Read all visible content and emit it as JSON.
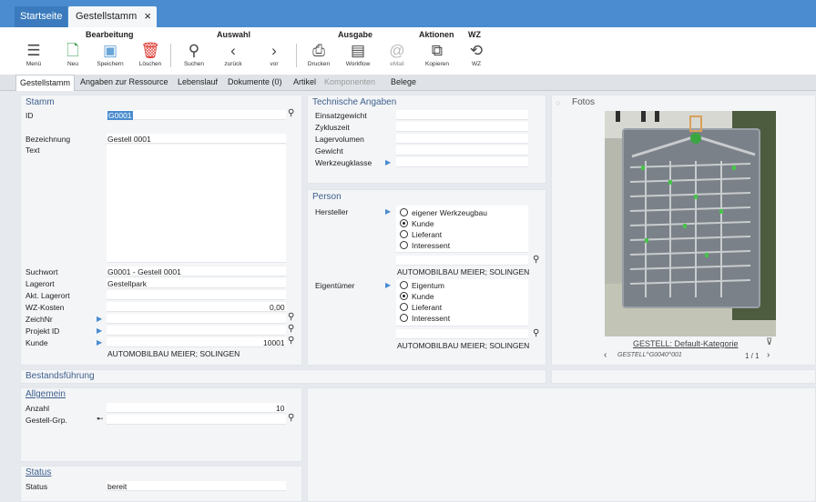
{
  "tabs": {
    "start": "Startseite",
    "current": "Gestellstamm",
    "close": "×"
  },
  "ribbon": {
    "groups": {
      "bearbeitung": "Bearbeitung",
      "auswahl": "Auswahl",
      "ausgabe": "Ausgabe",
      "aktionen": "Aktionen",
      "wz": "WZ"
    },
    "buttons": {
      "menu": "Menü",
      "neu": "Neu",
      "speichern": "Speichern",
      "loeschen": "Löschen",
      "suchen": "Suchen",
      "zurueck": "zurück",
      "vor": "vor",
      "drucken": "Drucken",
      "workflow": "Workflow",
      "email": "eMail",
      "kopieren": "Kopieren",
      "wz": "WZ"
    }
  },
  "subtabs": [
    "Gestellstamm",
    "Angaben zur Ressource",
    "Lebenslauf",
    "Dokumente (0)",
    "Artikel",
    "Komponenten",
    "Belege"
  ],
  "stamm": {
    "title": "Stamm",
    "id_label": "ID",
    "id_value": "G0001",
    "bez_label": "Bezeichnung",
    "bez_value": "Gestell 0001",
    "text_label": "Text",
    "suchwort_label": "Suchwort",
    "suchwort_value": "G0001 - Gestell 0001",
    "lagerort_label": "Lagerort",
    "lagerort_value": "Gestellpark",
    "aktlager_label": "Akt. Lagerort",
    "wzkosten_label": "WZ-Kosten",
    "wzkosten_value": "0,00",
    "zeichnr_label": "ZeichNr",
    "projekt_label": "Projekt ID",
    "kunde_label": "Kunde",
    "kunde_value": "10001",
    "kunde_name": "AUTOMOBILBAU MEIER; SOLINGEN"
  },
  "technik": {
    "title": "Technische Angaben",
    "einsatz": "Einsatzgewicht",
    "zyklus": "Zykluszeit",
    "lagervol": "Lagervolumen",
    "gewicht": "Gewicht",
    "wzklasse": "Werkzeugklasse"
  },
  "person": {
    "title": "Person",
    "hersteller_label": "Hersteller",
    "hersteller_options": [
      "eigener Werkzeugbau",
      "Kunde",
      "Lieferant",
      "Interessent"
    ],
    "hersteller_selected": "Kunde",
    "hersteller_name": "AUTOMOBILBAU MEIER; SOLINGEN",
    "eigentuemer_label": "Eigentümer",
    "eigentuemer_options": [
      "Eigentum",
      "Kunde",
      "Lieferant",
      "Interessent"
    ],
    "eigentuemer_selected": "Kunde",
    "eigentuemer_name": "AUTOMOBILBAU MEIER; SOLINGEN"
  },
  "fotos": {
    "title": "Fotos",
    "caption": "GESTELL: Default-Kategorie",
    "path": "GESTELL^G0040^001",
    "page": "1 / 1"
  },
  "bestand": {
    "title": "Bestandsführung"
  },
  "allgemein": {
    "title": "Allgemein",
    "anzahl_label": "Anzahl",
    "anzahl_value": "10",
    "grp_label": "Gestell-Grp."
  },
  "status": {
    "title": "Status",
    "status_label": "Status",
    "status_value": "bereit"
  },
  "colors": {
    "accent": "#4a8ccf",
    "title_bar": "#4a8ccf",
    "header_text": "#3c5f8c",
    "neu_icon": "#2e9b48",
    "loeschen_icon": "#d9342b"
  }
}
